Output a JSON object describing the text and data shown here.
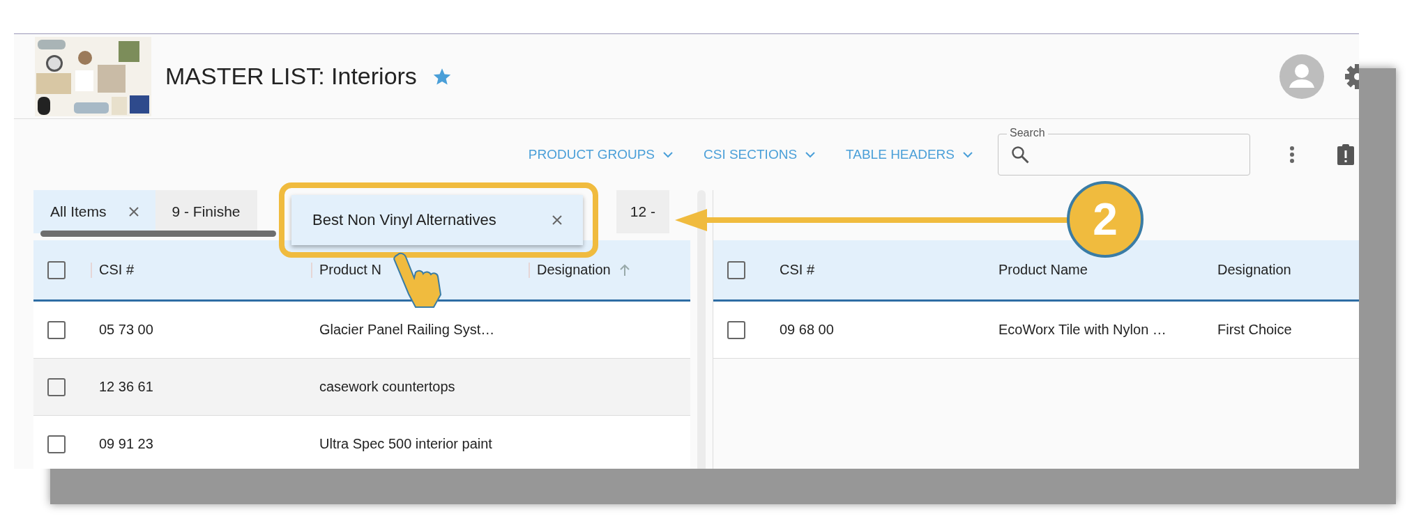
{
  "header": {
    "title": "MASTER LIST: Interiors",
    "favorite": true
  },
  "toolbar": {
    "menus": [
      "PRODUCT GROUPS",
      "CSI SECTIONS",
      "TABLE HEADERS"
    ],
    "search": {
      "label": "Search"
    }
  },
  "left_pane": {
    "tabs": [
      {
        "label": "All Items",
        "selected": true,
        "closable": true
      },
      {
        "label": "9 - Finishe",
        "selected": false,
        "closable": false
      },
      {
        "label": "12 -",
        "selected": false,
        "closable": false
      }
    ],
    "all_checked": false,
    "columns": [
      {
        "label": "CSI #"
      },
      {
        "label": "Product N"
      },
      {
        "label": "Designation",
        "sorted": true
      }
    ],
    "rows": [
      {
        "csi": "05 73 00",
        "product": "Glacier Panel Railing Syst…",
        "checked": false,
        "highlighted": false
      },
      {
        "csi": "12 36 61",
        "product": "casework countertops",
        "checked": false,
        "highlighted": true
      },
      {
        "csi": "09 91 23",
        "product": "Ultra Spec 500 interior paint",
        "checked": false,
        "highlighted": false
      }
    ]
  },
  "right_pane": {
    "all_checked": false,
    "columns": [
      {
        "label": "CSI #"
      },
      {
        "label": "Product Name"
      },
      {
        "label": "Designation"
      }
    ],
    "rows": [
      {
        "csi": "09 68 00",
        "product": "EcoWorx Tile with Nylon …",
        "designation": "First Choice",
        "checked": false,
        "highlighted": false
      }
    ]
  },
  "annotation": {
    "dragged_tab": {
      "label": "Best Non Vinyl Alternatives"
    },
    "step": "2"
  }
}
